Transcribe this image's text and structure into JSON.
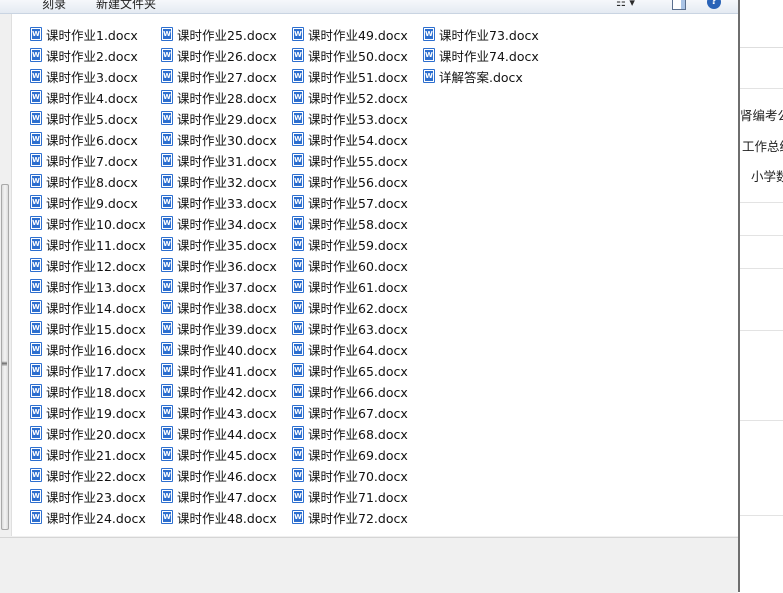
{
  "toolbar": {
    "burn_label": "刻录",
    "new_folder_label": "新建文件夹",
    "view_icon": "view-options-icon",
    "pane_icon": "preview-pane-icon",
    "help_icon": "help-icon",
    "view_glyph": "☷ ▾",
    "help_glyph": "?"
  },
  "file_icon": "word-document-icon",
  "files": [
    [
      "课时作业1.docx",
      "课时作业2.docx",
      "课时作业3.docx",
      "课时作业4.docx",
      "课时作业5.docx",
      "课时作业6.docx",
      "课时作业7.docx",
      "课时作业8.docx",
      "课时作业9.docx",
      "课时作业10.docx",
      "课时作业11.docx",
      "课时作业12.docx",
      "课时作业13.docx",
      "课时作业14.docx",
      "课时作业15.docx",
      "课时作业16.docx",
      "课时作业17.docx",
      "课时作业18.docx",
      "课时作业19.docx",
      "课时作业20.docx",
      "课时作业21.docx",
      "课时作业22.docx",
      "课时作业23.docx",
      "课时作业24.docx"
    ],
    [
      "课时作业25.docx",
      "课时作业26.docx",
      "课时作业27.docx",
      "课时作业28.docx",
      "课时作业29.docx",
      "课时作业30.docx",
      "课时作业31.docx",
      "课时作业32.docx",
      "课时作业33.docx",
      "课时作业34.docx",
      "课时作业35.docx",
      "课时作业36.docx",
      "课时作业37.docx",
      "课时作业38.docx",
      "课时作业39.docx",
      "课时作业40.docx",
      "课时作业41.docx",
      "课时作业42.docx",
      "课时作业43.docx",
      "课时作业44.docx",
      "课时作业45.docx",
      "课时作业46.docx",
      "课时作业47.docx",
      "课时作业48.docx"
    ],
    [
      "课时作业49.docx",
      "课时作业50.docx",
      "课时作业51.docx",
      "课时作业52.docx",
      "课时作业53.docx",
      "课时作业54.docx",
      "课时作业55.docx",
      "课时作业56.docx",
      "课时作业57.docx",
      "课时作业58.docx",
      "课时作业59.docx",
      "课时作业60.docx",
      "课时作业61.docx",
      "课时作业62.docx",
      "课时作业63.docx",
      "课时作业64.docx",
      "课时作业65.docx",
      "课时作业66.docx",
      "课时作业67.docx",
      "课时作业68.docx",
      "课时作业69.docx",
      "课时作业70.docx",
      "课时作业71.docx",
      "课时作业72.docx"
    ],
    [
      "课时作业73.docx",
      "课时作业74.docx",
      "详解答案.docx"
    ]
  ],
  "background_window": {
    "text_1": "肾编考公",
    "text_2": "工作总结",
    "text_3": "小学数"
  },
  "colors": {
    "word_icon": "#2d6fcf",
    "window_frame": "#f0f0f0"
  }
}
